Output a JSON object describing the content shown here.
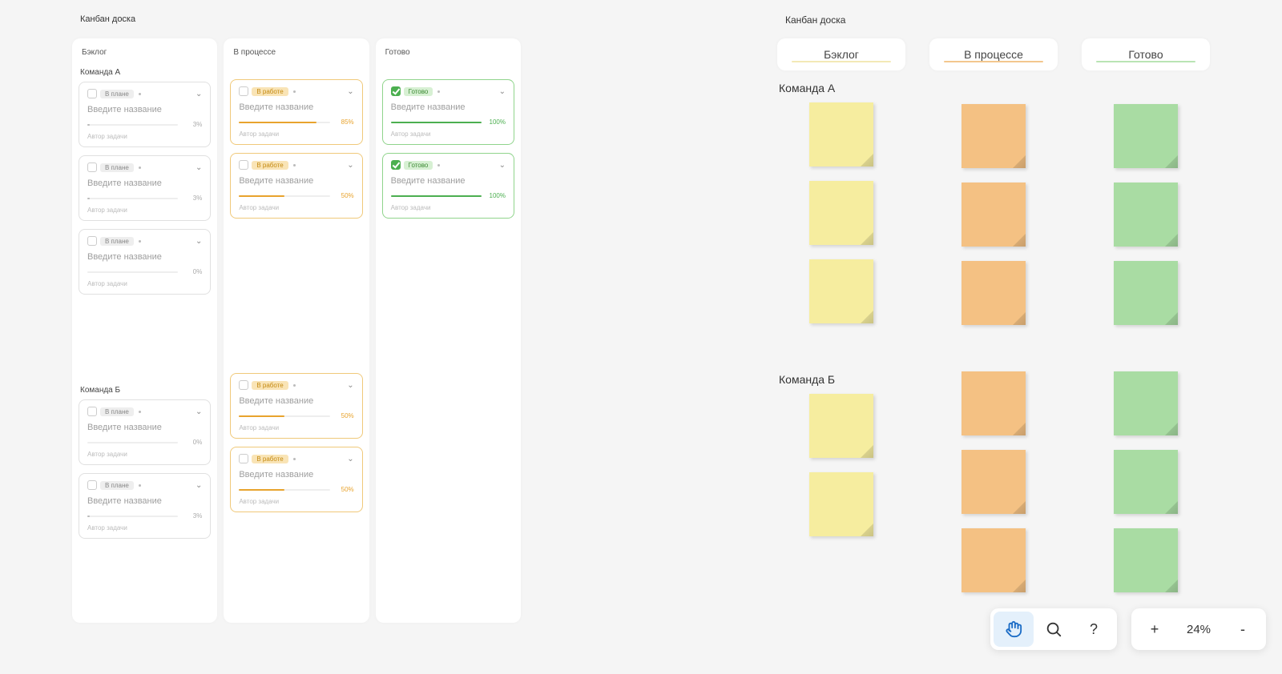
{
  "left_board": {
    "title": "Канбан доска",
    "columns": [
      {
        "key": "backlog",
        "title": "Бэклог",
        "groups": [
          {
            "label": "Команда А",
            "cards": [
              {
                "status_key": "plan",
                "status": "В плане",
                "title": "Введите название",
                "percent": 3,
                "author": "Автор задачи"
              },
              {
                "status_key": "plan",
                "status": "В плане",
                "title": "Введите название",
                "percent": 3,
                "author": "Автор задачи"
              },
              {
                "status_key": "plan",
                "status": "В плане",
                "title": "Введите название",
                "percent": 0,
                "author": "Автор задачи"
              }
            ]
          },
          {
            "label": "Команда Б",
            "cards": [
              {
                "status_key": "plan",
                "status": "В плане",
                "title": "Введите название",
                "percent": 0,
                "author": "Автор задачи"
              },
              {
                "status_key": "plan",
                "status": "В плане",
                "title": "Введите название",
                "percent": 3,
                "author": "Автор задачи"
              }
            ]
          }
        ]
      },
      {
        "key": "progress",
        "title": "В процессе",
        "groups": [
          {
            "label": "",
            "cards": [
              {
                "status_key": "work",
                "status": "В работе",
                "title": "Введите название",
                "percent": 85,
                "author": "Автор задачи"
              },
              {
                "status_key": "work",
                "status": "В работе",
                "title": "Введите название",
                "percent": 50,
                "author": "Автор задачи"
              }
            ]
          },
          {
            "label": "",
            "cards": [
              {
                "status_key": "work",
                "status": "В работе",
                "title": "Введите название",
                "percent": 50,
                "author": "Автор задачи"
              },
              {
                "status_key": "work",
                "status": "В работе",
                "title": "Введите название",
                "percent": 50,
                "author": "Автор задачи"
              }
            ]
          }
        ]
      },
      {
        "key": "done",
        "title": "Готово",
        "groups": [
          {
            "label": "",
            "cards": [
              {
                "status_key": "finished",
                "status": "Готово",
                "title": "Введите название",
                "percent": 100,
                "author": "Автор задачи"
              },
              {
                "status_key": "finished",
                "status": "Готово",
                "title": "Введите название",
                "percent": 100,
                "author": "Автор задачи"
              }
            ]
          },
          {
            "label": "",
            "cards": []
          }
        ]
      }
    ]
  },
  "right_board": {
    "title": "Канбан доска",
    "columns": [
      {
        "key": "backlog",
        "title": "Бэклог",
        "groups": [
          {
            "label": "Команда А",
            "count": 3
          },
          {
            "label": "Команда Б",
            "count": 2
          }
        ]
      },
      {
        "key": "progress",
        "title": "В процессе",
        "groups": [
          {
            "label": "",
            "count": 3
          },
          {
            "label": "",
            "count": 3
          }
        ]
      },
      {
        "key": "done",
        "title": "Готово",
        "groups": [
          {
            "label": "",
            "count": 3
          },
          {
            "label": "",
            "count": 3
          }
        ]
      }
    ]
  },
  "toolbar": {
    "hand_active": true,
    "zoom": "24%",
    "plus": "+",
    "minus": "-",
    "help": "?"
  }
}
